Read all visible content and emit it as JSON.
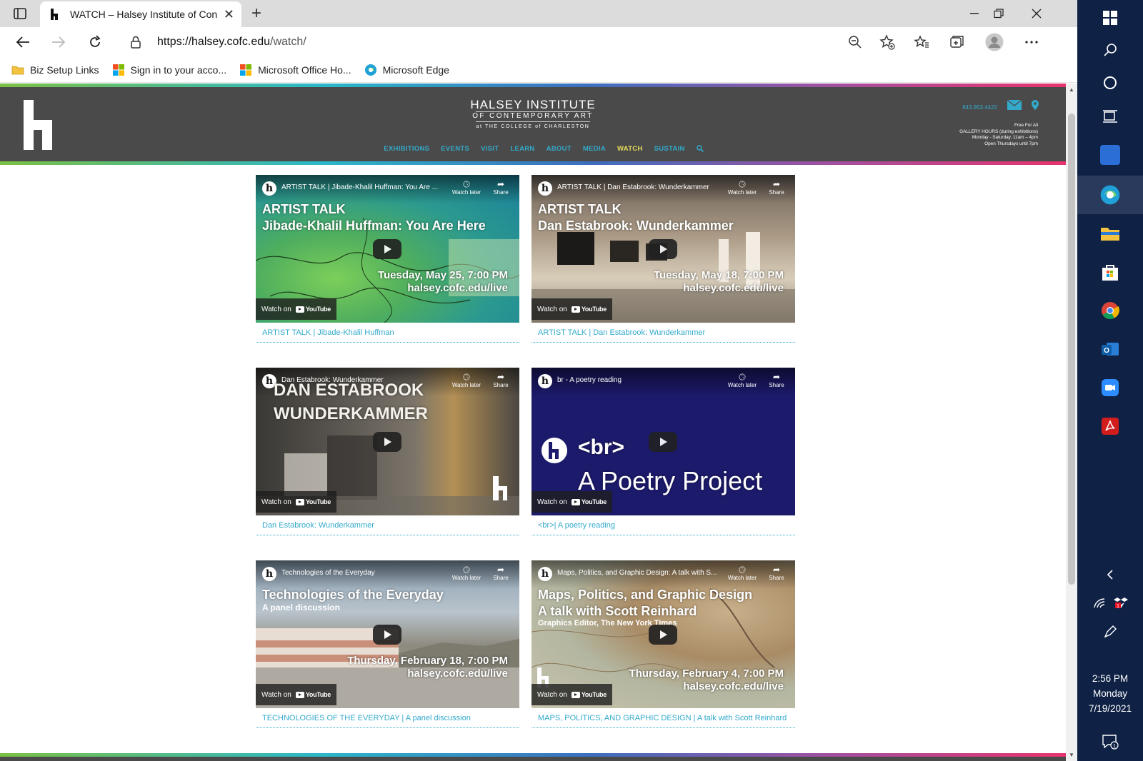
{
  "browser": {
    "tab_title": "WATCH – Halsey Institute of Con",
    "url_host": "https://halsey.cofc.edu",
    "url_path": "/watch/",
    "bookmarks": [
      {
        "label": "Biz Setup Links",
        "icon": "folder-icon"
      },
      {
        "label": "Sign in to your acco...",
        "icon": "microsoft-icon"
      },
      {
        "label": "Microsoft Office Ho...",
        "icon": "microsoft-icon"
      },
      {
        "label": "Microsoft Edge",
        "icon": "edge-icon"
      }
    ]
  },
  "site": {
    "name_line1": "HALSEY INSTITUTE",
    "name_line2": "OF CONTEMPORARY ART",
    "name_line3": "at THE COLLEGE of CHARLESTON",
    "phone": "843.953.4422",
    "free": "Free For All",
    "hours_title": "GALLERY HOURS (during exhibitions)",
    "hours_days": "Monday - Saturday, 11am – 4pm",
    "hours_thu": "Open Thursdays until 7pm",
    "nav": [
      "EXHIBITIONS",
      "EVENTS",
      "VISIT",
      "LEARN",
      "ABOUT",
      "MEDIA",
      "WATCH",
      "SUSTAIN"
    ],
    "nav_active": "WATCH",
    "accent": "#33aacb",
    "active_nav_color": "#e8dc5a",
    "header_bg": "#4a4a4a"
  },
  "videos": [
    {
      "video_title": "ARTIST TALK | Jibade-Khalil Huffman: You Are ...",
      "overlay1": "ARTIST TALK",
      "overlay2": "Jibade-Khalil Huffman: You Are Here",
      "date": "Tuesday, May 25, 7:00 PM",
      "link": "halsey.cofc.edu/live",
      "caption": "ARTIST TALK | Jibade-Khalil Huffman"
    },
    {
      "video_title": "ARTIST TALK | Dan Estabrook: Wunderkammer",
      "overlay1": "ARTIST TALK",
      "overlay2": "Dan Estabrook: Wunderkammer",
      "date": "Tuesday, May 18, 7:00 PM",
      "link": "halsey.cofc.edu/live",
      "caption": "ARTIST TALK | Dan Estabrook: Wunderkammer"
    },
    {
      "video_title": "Dan Estabrook: Wunderkammer",
      "overlay1": "DAN ESTABROOK",
      "overlay2": "WUNDERKAMMER",
      "caption": "Dan Estabrook: Wunderkammer"
    },
    {
      "video_title": "br - A poetry reading",
      "overlay1": "<br>",
      "overlay2": "A Poetry Project",
      "caption": "<br>| A poetry reading"
    },
    {
      "video_title": "Technologies of the Everyday",
      "overlay1": "Technologies of the Everyday",
      "overlay2": "A panel discussion",
      "date": "Thursday, February 18, 7:00 PM",
      "link": "halsey.cofc.edu/live",
      "caption": "TECHNOLOGIES OF THE EVERYDAY | A panel discussion"
    },
    {
      "video_title": "Maps, Politics, and Graphic Design: A talk with S...",
      "overlay1": "Maps, Politics, and Graphic Design",
      "overlay2": "A talk with Scott Reinhard",
      "overlay3": "Graphics Editor, The New York Times",
      "date": "Thursday, February 4, 7:00 PM",
      "link": "halsey.cofc.edu/live",
      "caption": "MAPS, POLITICS, AND GRAPHIC DESIGN | A talk with Scott Reinhard"
    }
  ],
  "video_ui": {
    "watch_later": "Watch later",
    "share": "Share",
    "watch_on": "Watch on",
    "youtube": "YouTube"
  },
  "taskbar": {
    "time": "2:56 PM",
    "day": "Monday",
    "date": "7/19/2021",
    "bg": "#0f2246"
  }
}
